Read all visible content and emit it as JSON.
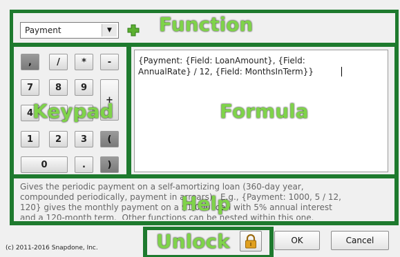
{
  "function": {
    "selected": "Payment",
    "label": "Function"
  },
  "keypad": {
    "label": "Keypad",
    "keys": {
      "comma": ",",
      "divide": "/",
      "multiply": "*",
      "minus": "-",
      "seven": "7",
      "eight": "8",
      "nine": "9",
      "plus": "+",
      "four": "4",
      "one": "1",
      "two": "2",
      "three": "3",
      "open_paren": "(",
      "zero": "0",
      "dot": ".",
      "close_paren": ")"
    }
  },
  "formula": {
    "label": "Formula",
    "text": "{Payment: {Field: LoanAmount}, {Field:\nAnnualRate} / 12, {Field: MonthsInTerm}}"
  },
  "help": {
    "label": "Help",
    "text": "Gives the periodic payment on a self-amortizing loan (360-day year,\ncompounded periodically, payment in arrears).  E.g., {Payment: 1000, 5 / 12,\n120} gives the monthly payment on a $1,000 loan with 5% annual interest\nand a 120-month term.  Other functions can be nested within this one."
  },
  "footer": {
    "copyright": "(c) 2011-2016 Snapdone, Inc.",
    "unlock_label": "Unlock",
    "ok": "OK",
    "cancel": "Cancel"
  },
  "colors": {
    "annotation_frame": "#1e7a2e",
    "annotation_text": "#7fd34a",
    "add_icon": "#5cb030",
    "lock_icon": "#e0a020"
  }
}
